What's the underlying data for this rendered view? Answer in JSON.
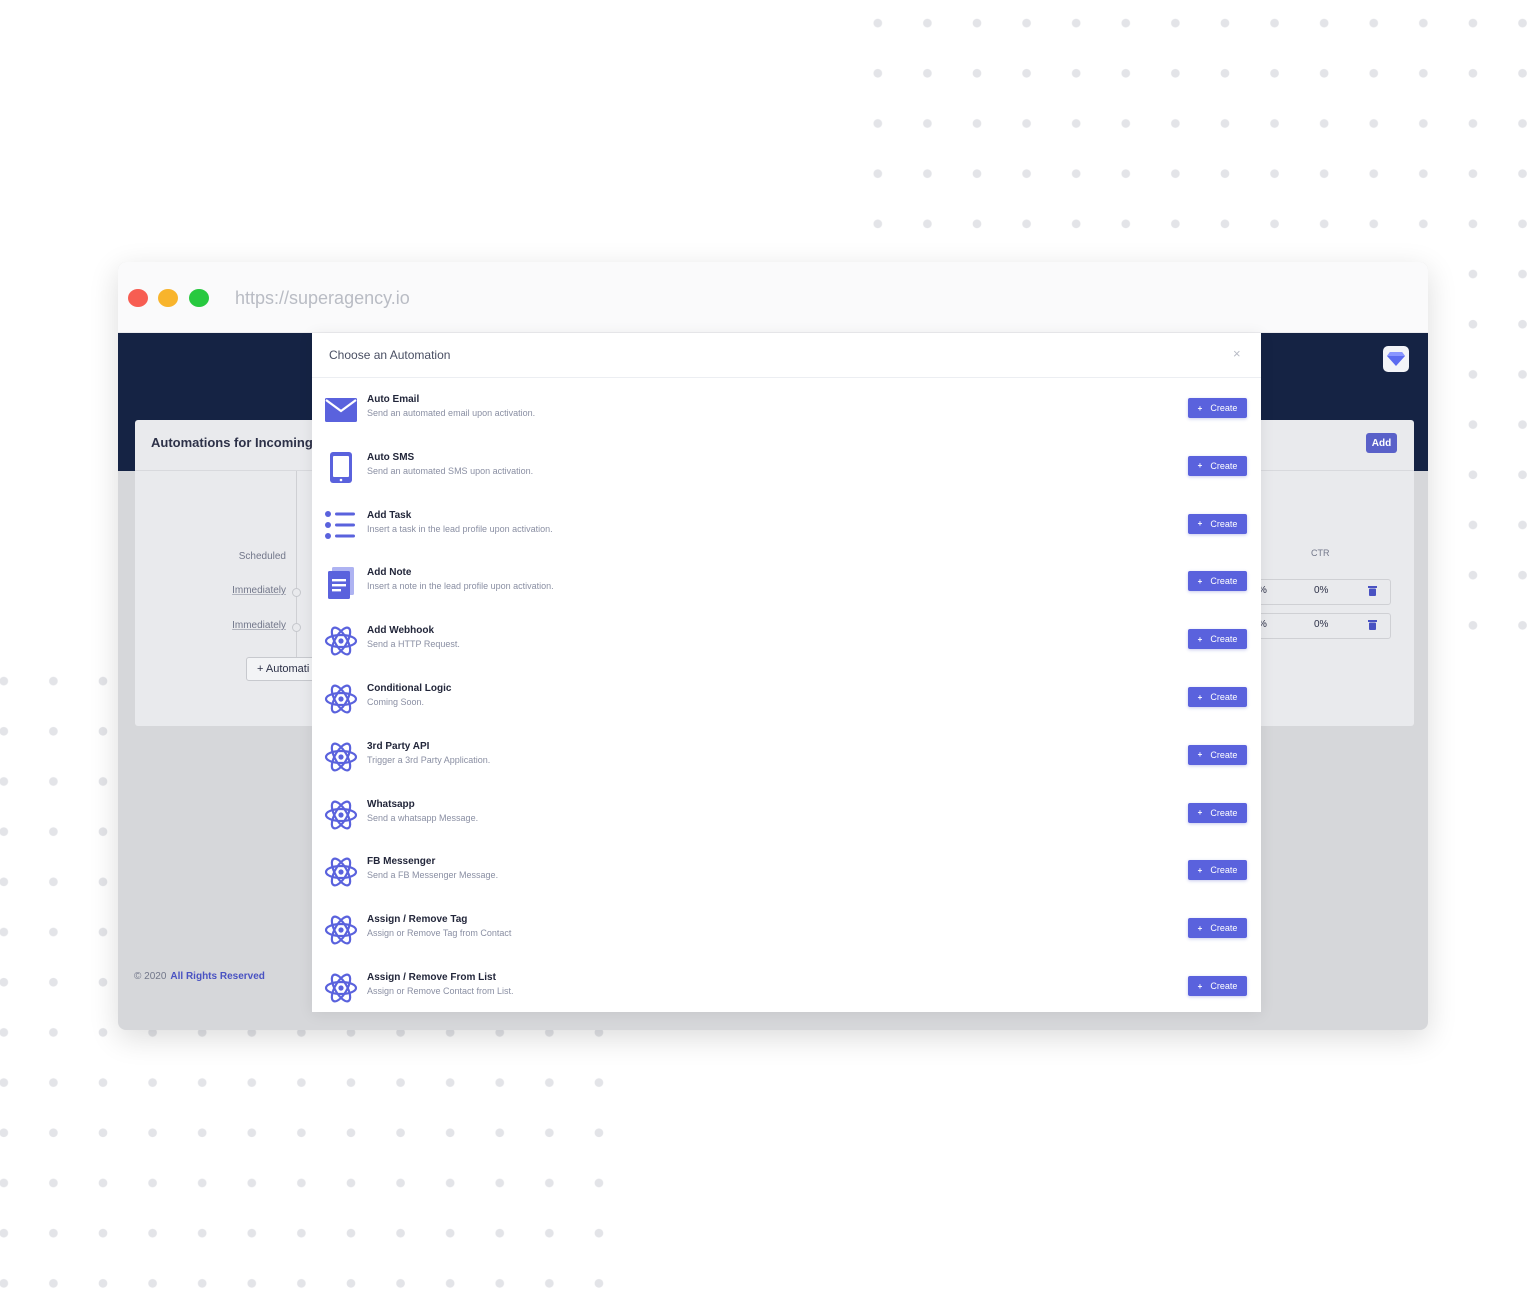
{
  "browser": {
    "url": "https://superagency.io"
  },
  "background_page": {
    "card_title": "Automations for Incoming L",
    "add_button": "Add",
    "scheduled_label": "Scheduled",
    "rows": [
      {
        "timing": "Immediately",
        "pct_fragment": "%",
        "ctr": "0%"
      },
      {
        "timing": "Immediately",
        "pct_fragment": "%",
        "ctr": "0%"
      }
    ],
    "ctr_header": "CTR",
    "automation_button": "+ Automati",
    "footer_copyright": "© 2020",
    "footer_link": "All Rights Reserved"
  },
  "modal": {
    "title": "Choose an Automation",
    "close_symbol": "×",
    "create_plus": "+",
    "create_label": "Create",
    "items": [
      {
        "name": "Auto Email",
        "description": "Send an automated email upon activation.",
        "icon": "envelope-icon"
      },
      {
        "name": "Auto SMS",
        "description": "Send an automated SMS upon activation.",
        "icon": "tablet-icon"
      },
      {
        "name": "Add Task",
        "description": "Insert a task in the lead profile upon activation.",
        "icon": "task-list-icon"
      },
      {
        "name": "Add Note",
        "description": "Insert a note in the lead profile upon activation.",
        "icon": "note-icon"
      },
      {
        "name": "Add Webhook",
        "description": "Send a HTTP Request.",
        "icon": "atom-icon"
      },
      {
        "name": "Conditional Logic",
        "description": "Coming Soon.",
        "icon": "atom-icon"
      },
      {
        "name": "3rd Party API",
        "description": "Trigger a 3rd Party Application.",
        "icon": "atom-icon"
      },
      {
        "name": "Whatsapp",
        "description": "Send a whatsapp Message.",
        "icon": "atom-icon"
      },
      {
        "name": "FB Messenger",
        "description": "Send a FB Messenger Message.",
        "icon": "atom-icon"
      },
      {
        "name": "Assign / Remove Tag",
        "description": "Assign or Remove Tag from Contact",
        "icon": "atom-icon"
      },
      {
        "name": "Assign / Remove From List",
        "description": "Assign or Remove Contact from List.",
        "icon": "atom-icon"
      }
    ]
  },
  "colors": {
    "accent": "#5a62dd",
    "header_navy": "#152344",
    "link_blue": "#4952c2"
  }
}
